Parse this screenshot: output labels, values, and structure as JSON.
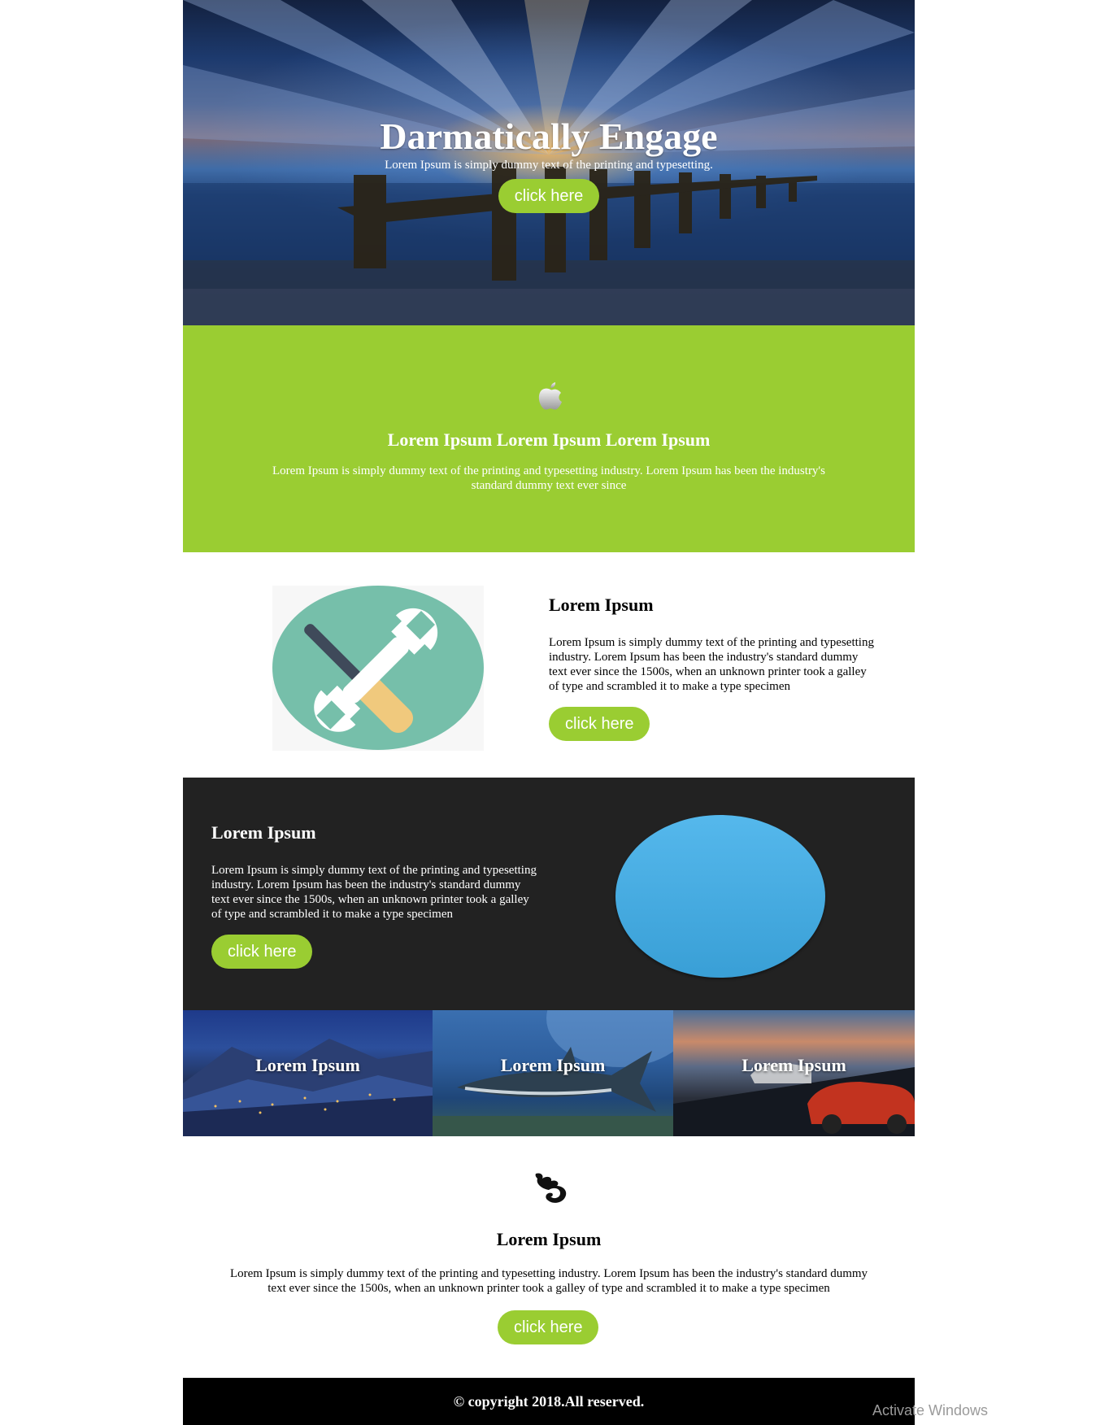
{
  "hero": {
    "title": "Darmatically Engage",
    "subtitle": "Lorem Ipsum is simply dummy text of the printing and typesetting.",
    "button": "click here"
  },
  "green_section": {
    "icon": "apple-icon",
    "title": "Lorem Ipsum Lorem Ipsum Lorem Ipsum",
    "text": "Lorem Ipsum is simply dummy text of the printing and typesetting industry. Lorem Ipsum has been the industry's standard dummy text ever since"
  },
  "feature": {
    "image_icon": "tools-icon",
    "title": "Lorem Ipsum",
    "text": "Lorem Ipsum is simply dummy text of the printing and typesetting industry. Lorem Ipsum has been the industry's standard dummy text ever since the 1500s, when an unknown printer took a galley of type and scrambled it to make a type specimen",
    "button": "click here"
  },
  "dark_section": {
    "title": "Lorem Ipsum",
    "text": "Lorem Ipsum is simply dummy text of the printing and typesetting industry. Lorem Ipsum has been the industry's standard dummy text ever since the 1500s, when an unknown printer took a galley of type and scrambled it to make a type specimen",
    "button": "click here"
  },
  "gallery": [
    {
      "label": "Lorem Ipsum"
    },
    {
      "label": "Lorem Ipsum"
    },
    {
      "label": "Lorem Ipsum"
    }
  ],
  "bottom_section": {
    "icon": "phoenix-icon",
    "title": "Lorem Ipsum",
    "text": "Lorem Ipsum is simply dummy text of the printing and typesetting industry. Lorem Ipsum has been the industry's standard dummy text ever since the 1500s, when an unknown printer took a galley of type and scrambled it to make a type specimen",
    "button": "click here"
  },
  "footer": {
    "text": "© copyright 2018.All reserved."
  },
  "os_overlay": {
    "text": "Activate Windows"
  },
  "colors": {
    "accent_green": "#9acd32",
    "dark_bg": "#222222",
    "footer_bg": "#000000",
    "oval_blue": "#4aaee3"
  }
}
